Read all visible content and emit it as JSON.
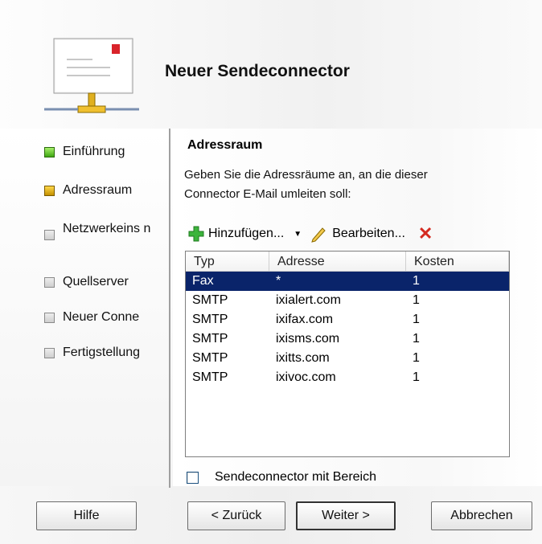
{
  "wizard": {
    "title": "Neuer Sendeconnector"
  },
  "nav": {
    "items": [
      {
        "label": "Einführung",
        "state": "done"
      },
      {
        "label": "Adressraum",
        "state": "current"
      },
      {
        "label": "Netzwerkeins n",
        "state": "pending"
      },
      {
        "label": "Quellserver",
        "state": "pending"
      },
      {
        "label": "Neuer Conne",
        "state": "pending"
      },
      {
        "label": "Fertigstellung",
        "state": "pending"
      }
    ]
  },
  "page": {
    "section_title": "Adressraum",
    "description_line1": "Geben Sie die Adressräume an, an die dieser",
    "description_line2": "Connector E-Mail umleiten soll:"
  },
  "toolbar": {
    "add_label": "Hinzufügen...",
    "edit_label": "Bearbeiten..."
  },
  "table": {
    "columns": [
      "Typ",
      "Adresse",
      "Kosten"
    ],
    "rows": [
      {
        "typ": "Fax",
        "adresse": "*",
        "kosten": "1",
        "selected": true
      },
      {
        "typ": "SMTP",
        "adresse": "ixialert.com",
        "kosten": "1"
      },
      {
        "typ": "SMTP",
        "adresse": "ixifax.com",
        "kosten": "1"
      },
      {
        "typ": "SMTP",
        "adresse": "ixisms.com",
        "kosten": "1"
      },
      {
        "typ": "SMTP",
        "adresse": "ixitts.com",
        "kosten": "1"
      },
      {
        "typ": "SMTP",
        "adresse": "ixivoc.com",
        "kosten": "1"
      }
    ]
  },
  "scope_checkbox": {
    "label": "Sendeconnector mit Bereich",
    "checked": false
  },
  "buttons": {
    "help": "Hilfe",
    "back": "< Zurück",
    "next": "Weiter >",
    "cancel": "Abbrechen"
  },
  "colors": {
    "selection": "#0a246a",
    "done_indicator": "#3fa712",
    "current_indicator": "#e0b020",
    "remove_icon": "#d42a20",
    "add_icon": "#3cb43c"
  }
}
